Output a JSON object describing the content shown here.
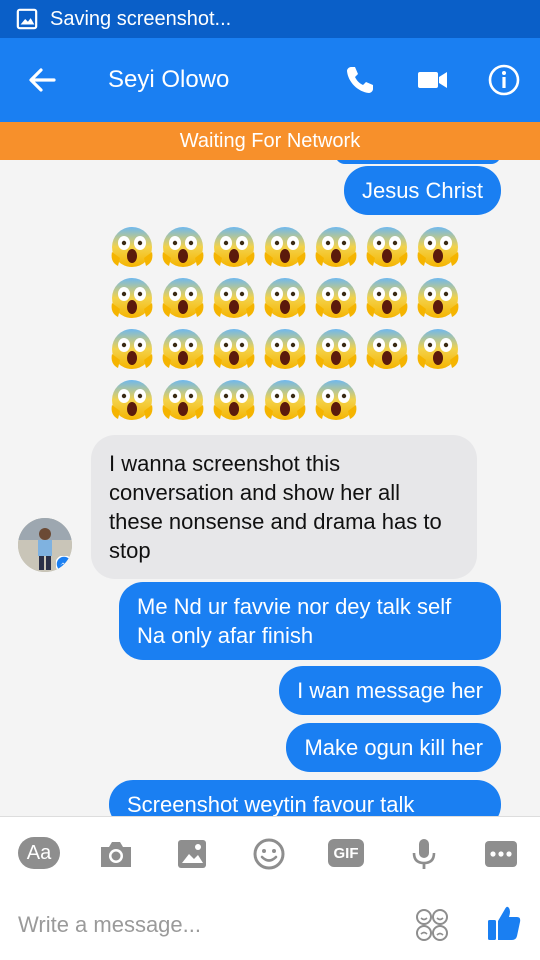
{
  "status_bar": {
    "text": "Saving screenshot..."
  },
  "header": {
    "contact_name": "Seyi Olowo"
  },
  "banner": {
    "text": "Waiting For Network"
  },
  "messages": [
    {
      "dir": "out",
      "text": "Jesus Christ"
    },
    {
      "dir": "emoji",
      "emoji": "face-screaming-in-fear",
      "count": 26
    },
    {
      "dir": "in",
      "text": "I wanna screenshot this conversation and show her all these nonsense and drama has to stop"
    },
    {
      "dir": "out",
      "text": "Me Nd ur favvie nor dey talk self Na only afar finish"
    },
    {
      "dir": "out",
      "text": "I wan message her"
    },
    {
      "dir": "out",
      "text": "Make ogun kill her"
    },
    {
      "dir": "out",
      "text": "Screenshot weytin favour talk"
    }
  ],
  "toolbar": {
    "aa_label": "Aa",
    "gif_label": "GIF"
  },
  "composer": {
    "placeholder": "Write a message..."
  },
  "colors": {
    "accent": "#1a7ff2",
    "status": "#0a5fc8",
    "banner": "#f7902b",
    "incoming": "#e7e7e9"
  }
}
